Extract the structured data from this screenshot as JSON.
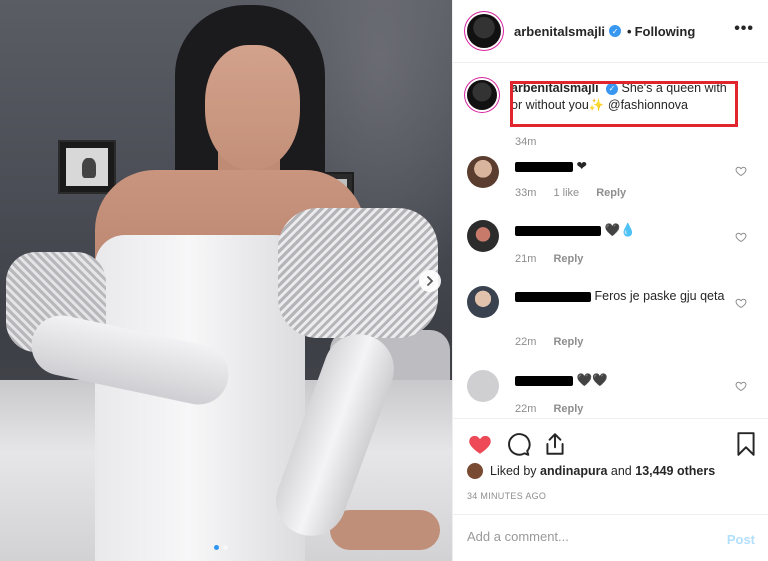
{
  "header": {
    "username": "arbenitalsmajli",
    "separator": "•",
    "follow_status": "Following",
    "more_label": "•••"
  },
  "caption": {
    "username": "arbenitalsmajli",
    "text": "She's a queen with or without you",
    "emoji": "✨",
    "mention": "@fashionnova",
    "time": "34m"
  },
  "comments": [
    {
      "suffix": "❤",
      "time": "33m",
      "likes": "1 like",
      "reply": "Reply"
    },
    {
      "suffix": "🖤💧",
      "time": "21m",
      "reply": "Reply"
    },
    {
      "text": "Feros je paske gju qeta",
      "time": "22m",
      "reply": "Reply"
    },
    {
      "suffix": "🖤🖤",
      "time": "22m",
      "reply": "Reply"
    }
  ],
  "likes": {
    "prefix": "Liked by",
    "user": "andinapura",
    "conjunction": "and",
    "count": "13,449 others"
  },
  "posted_time": "34 MINUTES AGO",
  "add_comment": {
    "placeholder": "Add a comment...",
    "post_label": "Post"
  },
  "icons": {
    "heart": "heart-icon",
    "comment": "comment-icon",
    "share": "share-icon",
    "save": "bookmark-icon",
    "next": "chevron-right-icon"
  },
  "colors": {
    "like_red": "#ed4956",
    "verified_blue": "#3897f0",
    "highlight_red": "#e0262c",
    "post_disabled": "#b2dffc"
  },
  "carousel": {
    "count": 2,
    "active": 1
  }
}
